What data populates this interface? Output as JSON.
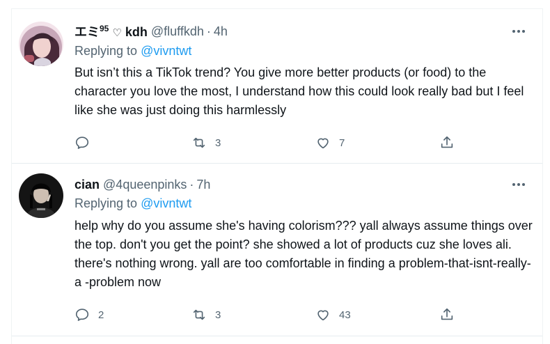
{
  "tweets": [
    {
      "display_name": "エミ",
      "display_name_sup": "95",
      "display_name_heart": "♡",
      "display_name_tail": "kdh",
      "handle": "@fluffkdh",
      "separator": "·",
      "time": "4h",
      "replying_prefix": "Replying to",
      "replying_to": "@vivntwt",
      "text": "But isn’t this a TikTok trend? You give more better products (or food) to the character you love the most, I understand how this could look really bad but I feel like she was just doing this harmlessly",
      "reply_count": "",
      "retweet_count": "3",
      "like_count": "7",
      "more_icon": "more-horizontal-icon",
      "avatar_colors": [
        "#b35a6a",
        "#3a2430"
      ]
    },
    {
      "display_name": "cian",
      "handle": "@4queenpinks",
      "separator": "·",
      "time": "7h",
      "replying_prefix": "Replying to",
      "replying_to": "@vivntwt",
      "text": "help why do you assume she's having colorism??? yall always assume things over the top. don't you get the point? she showed a lot of products cuz she loves ali. there's nothing wrong. yall are too comfortable in finding a problem-that-isnt-really-a -problem now",
      "reply_count": "2",
      "retweet_count": "3",
      "like_count": "43",
      "more_icon": "more-horizontal-icon",
      "avatar_colors": [
        "#1a1a1a",
        "#d8cfc4"
      ]
    }
  ],
  "colors": {
    "text": "#0f1419",
    "secondary": "#536471",
    "link": "#1d9bf0",
    "divider": "#e6ecf0"
  },
  "icons": {
    "reply": "reply-icon",
    "retweet": "retweet-icon",
    "like": "like-icon",
    "share": "share-icon"
  }
}
